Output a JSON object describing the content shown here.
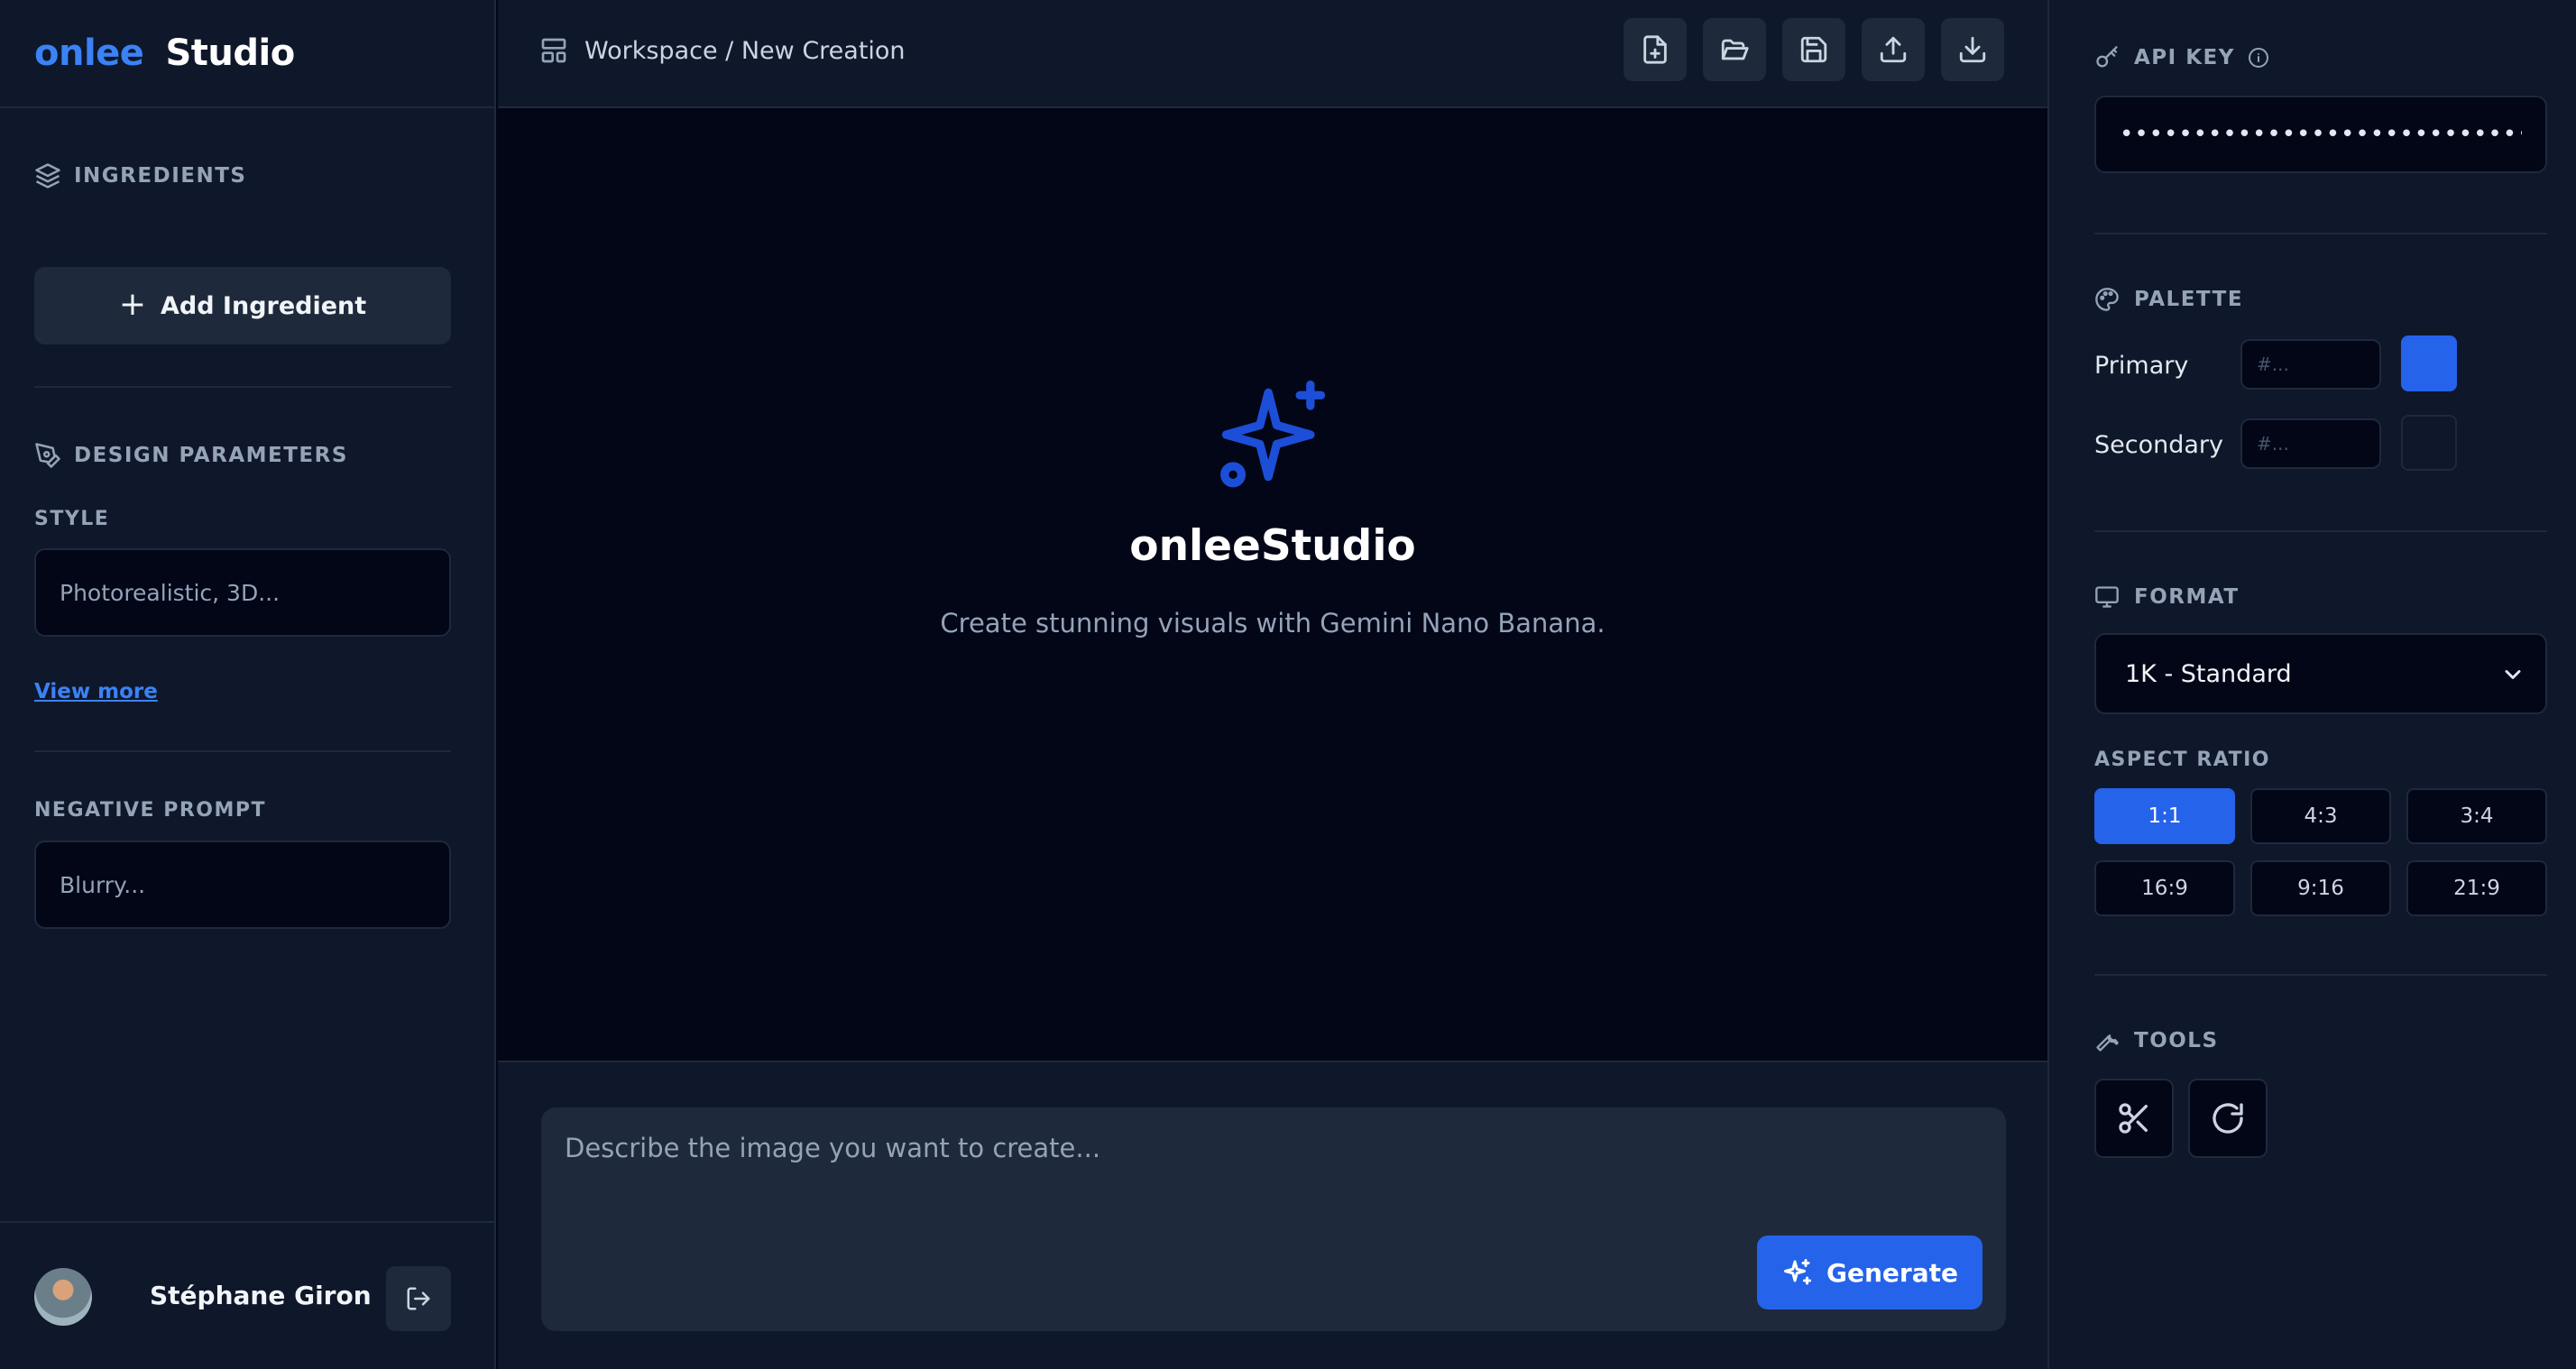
{
  "brand": {
    "part1": "onlee",
    "part2": "Studio"
  },
  "left": {
    "ingredients_heading": "INGREDIENTS",
    "add_ingredient_label": "Add Ingredient",
    "design_heading": "DESIGN PARAMETERS",
    "style_label": "STYLE",
    "style_placeholder": "Photorealistic, 3D...",
    "view_more": "View more",
    "negative_label": "NEGATIVE PROMPT",
    "negative_placeholder": "Blurry..."
  },
  "user": {
    "name": "Stéphane Giron"
  },
  "topbar": {
    "breadcrumb": "Workspace / New Creation"
  },
  "hero": {
    "title": "onleeStudio",
    "subtitle": "Create stunning visuals with Gemini Nano Banana."
  },
  "prompt": {
    "placeholder": "Describe the image you want to create...",
    "generate_label": "Generate"
  },
  "right": {
    "api_heading": "API KEY",
    "api_value": "••••••••••••••••••••••••••••••••••••••",
    "palette_heading": "PALETTE",
    "primary_label": "Primary",
    "secondary_label": "Secondary",
    "hex_placeholder": "#...",
    "primary_color": "#2563eb",
    "secondary_color": "#0f172a",
    "format_heading": "FORMAT",
    "format_value": "1K - Standard",
    "aspect_heading": "ASPECT RATIO",
    "aspect_ratios": [
      "1:1",
      "4:3",
      "3:4",
      "16:9",
      "9:16",
      "21:9"
    ],
    "aspect_selected": "1:1",
    "tools_heading": "TOOLS"
  },
  "icons": {
    "layers": "layers-icon",
    "pen": "pen-tool-icon",
    "plus": "plus-icon",
    "logout": "logout-icon",
    "layout": "layout-icon",
    "new_file": "file-plus-icon",
    "open": "folder-open-icon",
    "save": "save-icon",
    "upload": "upload-icon",
    "download": "download-icon",
    "sparkles": "sparkles-icon",
    "key": "key-icon",
    "info": "info-icon",
    "palette": "palette-icon",
    "monitor": "monitor-icon",
    "chevron": "chevron-down-icon",
    "wrench": "wrench-icon",
    "scissors": "scissors-icon",
    "rotate": "rotate-icon"
  }
}
